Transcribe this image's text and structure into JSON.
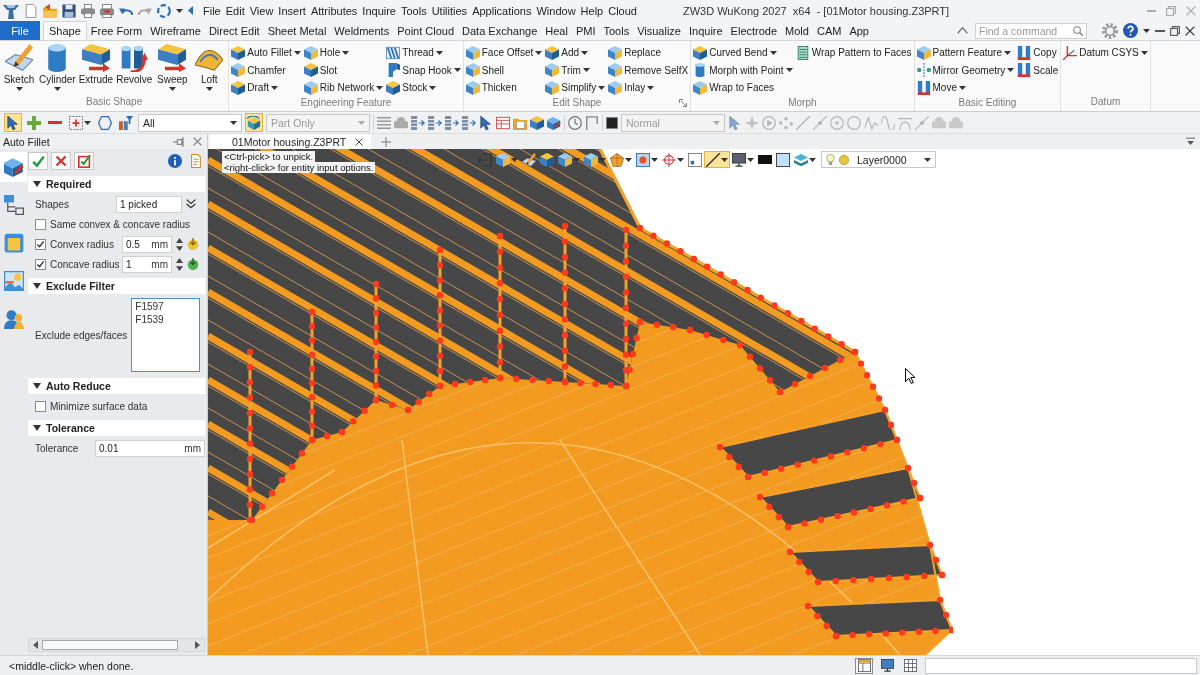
{
  "title_bar": {
    "menu": [
      "File",
      "Edit",
      "View",
      "Insert",
      "Attributes",
      "Inquire",
      "Tools",
      "Utilities",
      "Applications",
      "Window",
      "Help",
      "Cloud"
    ],
    "title": "ZW3D WuKong 2027  x64  - [01Motor housing.Z3PRT]"
  },
  "ribbon": {
    "file_button": "File",
    "tabs": [
      {
        "label": "Shape",
        "selected": true
      },
      {
        "label": "Free Form",
        "selected": false
      },
      {
        "label": "Wireframe",
        "selected": false
      },
      {
        "label": "Direct Edit",
        "selected": false
      },
      {
        "label": "Sheet Metal",
        "selected": false
      },
      {
        "label": "Weldments",
        "selected": false
      },
      {
        "label": "Point Cloud",
        "selected": false
      },
      {
        "label": "Data Exchange",
        "selected": false
      },
      {
        "label": "Heal",
        "selected": false
      },
      {
        "label": "PMI",
        "selected": false
      },
      {
        "label": "Tools",
        "selected": false
      },
      {
        "label": "Visualize",
        "selected": false
      },
      {
        "label": "Inquire",
        "selected": false
      },
      {
        "label": "Electrode",
        "selected": false
      },
      {
        "label": "Mold",
        "selected": false
      },
      {
        "label": "CAM",
        "selected": false
      },
      {
        "label": "App",
        "selected": false
      }
    ],
    "search": {
      "placeholder": "Find a command"
    },
    "groups": [
      {
        "title": "Basic Shape",
        "launcher": false,
        "large_buttons": [
          {
            "label": "Sketch",
            "dropdown": true
          },
          {
            "label": "Cylinder",
            "dropdown": true
          },
          {
            "label": "Extrude",
            "dropdown": false
          },
          {
            "label": "Revolve",
            "dropdown": false
          },
          {
            "label": "Sweep",
            "dropdown": true
          },
          {
            "label": "Loft",
            "dropdown": true
          }
        ]
      },
      {
        "title": "Engineering Feature",
        "launcher": false,
        "columns": [
          [
            {
              "label": "Auto Fillet",
              "dropdown": true
            },
            {
              "label": "Chamfer",
              "dropdown": false
            },
            {
              "label": "Draft",
              "dropdown": true
            }
          ],
          [
            {
              "label": "Hole",
              "dropdown": true
            },
            {
              "label": "Slot",
              "dropdown": false
            },
            {
              "label": "Rib Network",
              "dropdown": true
            }
          ],
          [
            {
              "label": "Thread",
              "dropdown": true
            },
            {
              "label": "Snap Hook",
              "dropdown": true
            },
            {
              "label": "Stock",
              "dropdown": true
            }
          ]
        ]
      },
      {
        "title": "Edit Shape",
        "launcher": true,
        "columns": [
          [
            {
              "label": "Face Offset",
              "dropdown": true
            },
            {
              "label": "Shell",
              "dropdown": false
            },
            {
              "label": "Thicken",
              "dropdown": false
            }
          ],
          [
            {
              "label": "Add",
              "dropdown": true
            },
            {
              "label": "Trim",
              "dropdown": true
            },
            {
              "label": "Simplify",
              "dropdown": true
            }
          ],
          [
            {
              "label": "Replace",
              "dropdown": false
            },
            {
              "label": "Remove SelfX",
              "dropdown": false
            },
            {
              "label": "Inlay",
              "dropdown": true
            }
          ]
        ]
      },
      {
        "title": "Morph",
        "launcher": false,
        "columns": [
          [
            {
              "label": "Curved Bend",
              "dropdown": true
            },
            {
              "label": "Morph with Point",
              "dropdown": true
            },
            {
              "label": "Wrap to Faces",
              "dropdown": false
            }
          ],
          [
            {
              "label": "Wrap Pattern to Faces",
              "dropdown": false
            }
          ]
        ]
      },
      {
        "title": "Basic Editing",
        "launcher": false,
        "columns": [
          [
            {
              "label": "Pattern Feature",
              "dropdown": true
            },
            {
              "label": "Mirror Geometry",
              "dropdown": true
            },
            {
              "label": "Move",
              "dropdown": true
            }
          ],
          [
            {
              "label": "Copy",
              "dropdown": false
            },
            {
              "label": "Scale",
              "dropdown": false
            }
          ]
        ]
      },
      {
        "title": "Datum",
        "launcher": false,
        "columns": [
          [
            {
              "label": "Datum CSYS",
              "dropdown": true
            }
          ]
        ]
      }
    ]
  },
  "toolbar": {
    "tools": [
      {
        "selected": true
      },
      {
        "selected": false
      },
      {
        "selected": false
      },
      {
        "selected": false
      },
      {
        "selected": false
      },
      {
        "selected": false
      }
    ],
    "type_filter": {
      "value": "All",
      "disabled": false
    },
    "scope_toggle": {
      "selected": true
    },
    "scope_filter": {
      "value": "Part Only",
      "disabled": true
    },
    "mode_filter": {
      "value": "Normal",
      "disabled": true
    },
    "snap_tools_disabled": true
  },
  "panel": {
    "title": "Auto Fillet",
    "side_tabs": [
      {
        "selected": true
      },
      {
        "selected": false
      },
      {
        "selected": false
      },
      {
        "selected": false
      },
      {
        "selected": false
      }
    ],
    "sections": [
      {
        "title": "Required",
        "expanded": true,
        "rows": [
          {
            "kind": "field",
            "label": "Shapes",
            "value": "1 picked"
          },
          {
            "kind": "checkbox",
            "label": "Same convex & concave radius",
            "checked": false
          },
          {
            "kind": "number",
            "label": "Convex radius",
            "checked": true,
            "value": "0.5",
            "unit": "mm"
          },
          {
            "kind": "number",
            "label": "Concave radius",
            "checked": true,
            "value": "1",
            "unit": "mm"
          }
        ]
      },
      {
        "title": "Exclude Filter",
        "expanded": true,
        "rows": [
          {
            "kind": "list",
            "label": "Exclude edges/faces",
            "items": [
              "F1597",
              "F1539"
            ]
          }
        ]
      },
      {
        "title": "Auto Reduce",
        "expanded": true,
        "rows": [
          {
            "kind": "checkbox",
            "label": "Minimize surface data",
            "checked": false
          }
        ]
      },
      {
        "title": "Tolerance",
        "expanded": true,
        "rows": [
          {
            "kind": "text",
            "label": "Tolerance",
            "value": "0.01",
            "unit": "mm"
          }
        ]
      }
    ]
  },
  "document_tabs": [
    {
      "label": "01Motor housing.Z3PRT",
      "selected": true
    }
  ],
  "viewport": {
    "hints": [
      "<Ctrl-pick> to unpick.",
      "<right-click> for entity input options."
    ],
    "view_toolbar": {
      "tools": [
        {
          "selected": false
        },
        {
          "selected": false
        },
        {
          "selected": false
        },
        {
          "selected": false
        },
        {
          "selected": false
        },
        {
          "selected": false
        },
        {
          "selected": false
        },
        {
          "selected": false
        },
        {
          "selected": false
        },
        {
          "selected": false
        },
        {
          "selected": true
        },
        {
          "selected": false
        },
        {
          "selected": false
        },
        {
          "selected": false
        },
        {
          "selected": false
        }
      ],
      "layer": "Layer0000"
    }
  },
  "status_bar": {
    "message": "<middle-click> when done.",
    "tools": [
      {
        "selected": true
      },
      {
        "selected": false
      },
      {
        "selected": false
      }
    ]
  }
}
